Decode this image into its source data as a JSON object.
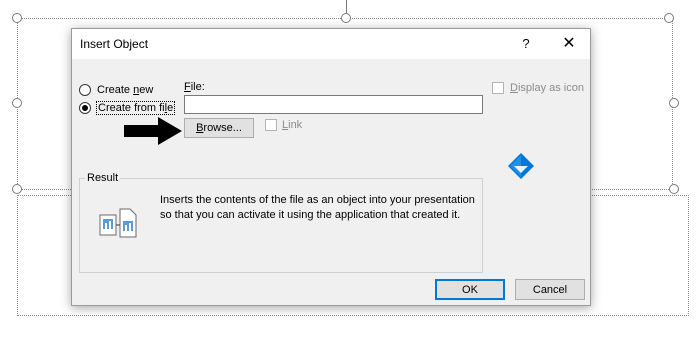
{
  "dialog": {
    "title": "Insert Object",
    "help_symbol": "?",
    "close_symbol": "✕",
    "options": {
      "create_new_prefix": "Create ",
      "create_new_key": "n",
      "create_new_suffix": "ew",
      "create_from_file_prefix": "Create from fi",
      "create_from_file_key": "l",
      "create_from_file_suffix": "e",
      "selected": "create_from_file"
    },
    "file": {
      "label_key": "F",
      "label_rest": "ile:",
      "value": ""
    },
    "browse": {
      "key": "B",
      "rest": "rowse..."
    },
    "link": {
      "key": "L",
      "rest": "ink",
      "checked": false,
      "enabled": false
    },
    "display_as_icon": {
      "key": "D",
      "rest": "isplay as icon",
      "checked": false,
      "enabled": false
    },
    "result": {
      "legend": "Result",
      "text": "Inserts the contents of the file as an object into your presentation so that you can activate it using the application that created it."
    },
    "ok_label": "OK",
    "cancel_label": "Cancel"
  },
  "colors": {
    "dialog_bg": "#f0f0f0",
    "titlebar_bg": "#ffffff",
    "default_button_border": "#0078d7",
    "logo_blue": "#0078d7"
  },
  "icons": [
    "help-icon",
    "close-icon",
    "arrow-right-icon",
    "document-chart-icon",
    "windows-logo-icon"
  ]
}
